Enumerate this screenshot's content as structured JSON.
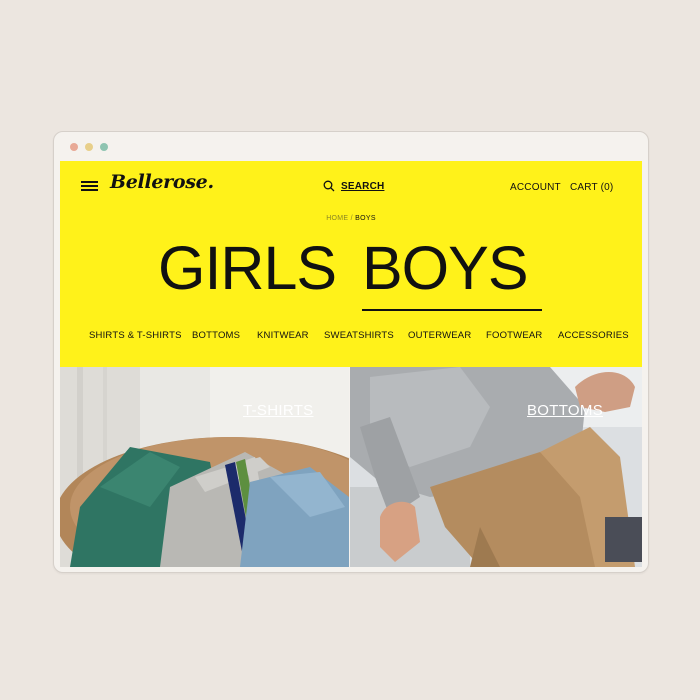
{
  "window": {
    "dots": [
      "#e8a996",
      "#e8cf8a",
      "#8fc4b1"
    ]
  },
  "header": {
    "logo": "Bellerose.",
    "search_label": "SEARCH",
    "account_label": "ACCOUNT",
    "cart_label": "CART (0)"
  },
  "breadcrumb": {
    "home": "HOME",
    "separator": "/",
    "current": "BOYS"
  },
  "gender_tabs": {
    "girls": "GIRLS",
    "boys": "BOYS",
    "active": "BOYS"
  },
  "categories": [
    "SHIRTS & T-SHIRTS",
    "BOTTOMS",
    "KNITWEAR",
    "SWEATSHIRTS",
    "OUTERWEAR",
    "FOOTWEAR",
    "ACCESSORIES"
  ],
  "tiles": [
    {
      "label": "T-SHIRTS"
    },
    {
      "label": "BOTTOMS"
    }
  ],
  "colors": {
    "brand_yellow": "#fff21a",
    "text": "#111111"
  }
}
